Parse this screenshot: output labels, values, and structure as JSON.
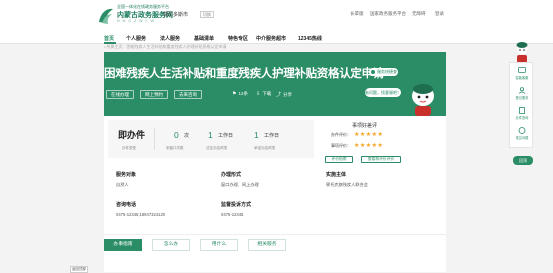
{
  "header": {
    "logo_top": "全国一体化在线政务服务平台",
    "logo_main": "内蒙古政务服务网",
    "logo_sub": "N M G Z W F W",
    "region_label": "鄂尔多斯市",
    "region_select": "切换",
    "links": [
      "长辈版",
      "国家政务服务平台",
      "无障碍",
      "登录"
    ]
  },
  "nav": {
    "items": [
      "首页",
      "个人服务",
      "法人服务",
      "基础清单",
      "特色专区",
      "中介服务超市",
      "12345热线"
    ],
    "active_index": 0
  },
  "breadcrumb": "• 所属主页：困难残疾人生活补贴和重度残疾人护理补贴资格认定申请",
  "hero": {
    "title": "困难残疾人生活补贴和重度残疾人护理补贴资格认定申请",
    "badge": "服务快捷查询",
    "buttons": [
      "在线办理",
      "网上预约",
      "去来咨询"
    ],
    "stats": [
      {
        "icon": "flag-icon",
        "value": "12条"
      },
      {
        "icon": "download-icon",
        "value": "下载"
      },
      {
        "icon": "share-icon",
        "value": "分享"
      }
    ],
    "bubble": "有问题，找客服吧！"
  },
  "stats": {
    "title": "即办件",
    "title_sub": "办件类型",
    "items": [
      {
        "num": "0",
        "unit": "次",
        "label": "到窗口次数"
      },
      {
        "num": "1",
        "unit": "工作日",
        "label": "法定办结时限"
      },
      {
        "num": "1",
        "unit": "工作日",
        "label": "承诺办结时限"
      }
    ]
  },
  "rating": {
    "title": "事项好差评",
    "rows": [
      {
        "label": "办件评价：",
        "stars": "★★★★★"
      },
      {
        "label": "事项评价：",
        "stars": "★★★★★"
      }
    ],
    "buttons": [
      "评价指南",
      "查看和评价评价"
    ]
  },
  "info": [
    {
      "label": "服务对象",
      "value": "自然人"
    },
    {
      "label": "办理形式",
      "value": "窗口办理、网上办理"
    },
    {
      "label": "实施主体",
      "value": "鄂托克旗残疾人联合会"
    },
    {
      "label": "咨询电话",
      "value": "0475-12345;18947324120"
    },
    {
      "label": "监督投诉方式",
      "value": "0475-12345"
    }
  ],
  "tabs": {
    "items": [
      "办事指南",
      "怎么办",
      "用什么",
      "相关服务"
    ],
    "active_index": 0
  },
  "footer_tag": "返回顶部",
  "sidebar": {
    "items": [
      "智能客服",
      "登记服务",
      "办件查询",
      "常见问题"
    ],
    "bottom_button": "回顶"
  },
  "colors": {
    "brand": "#2b8d66",
    "star": "#f4a11c"
  }
}
